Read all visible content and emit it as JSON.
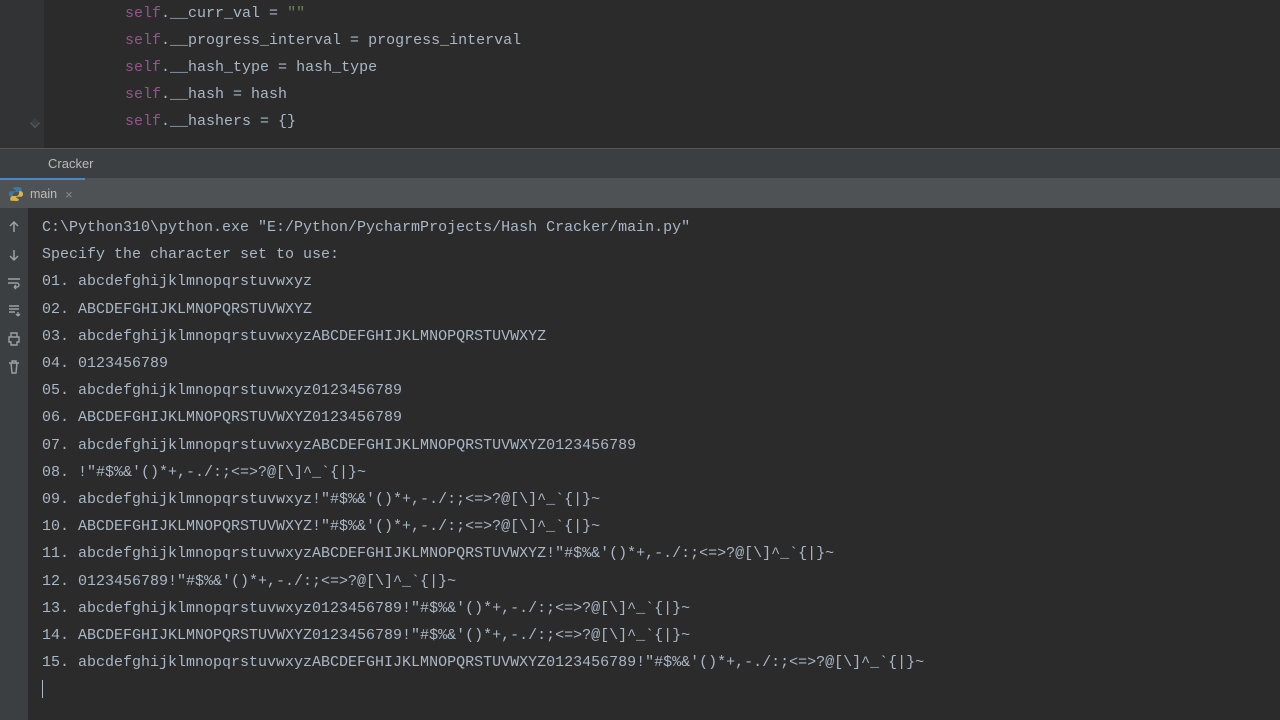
{
  "editor": {
    "lines": [
      {
        "self": "self",
        "field": ".__curr_val",
        "op": " = ",
        "rhs_type": "str",
        "rhs": "\"\""
      },
      {
        "self": "self",
        "field": ".__progress_interval",
        "op": " = ",
        "rhs_type": "ident",
        "rhs": "progress_interval"
      },
      {
        "self": "self",
        "field": ".__hash_type",
        "op": " = ",
        "rhs_type": "ident",
        "rhs": "hash_type"
      },
      {
        "self": "self",
        "field": ".__hash",
        "op": " = ",
        "rhs_type": "ident",
        "rhs": "hash"
      },
      {
        "self": "self",
        "field": ".__hashers",
        "op": " = ",
        "rhs_type": "brace",
        "rhs": "{}"
      }
    ]
  },
  "toolwindow": {
    "title": "Cracker"
  },
  "run_tab": {
    "label": "main",
    "close": "×"
  },
  "console": {
    "cmd": "C:\\Python310\\python.exe \"E:/Python/PycharmProjects/Hash Cracker/main.py\"",
    "prompt": "Specify the character set to use:",
    "blank": "",
    "options": [
      "01. abcdefghijklmnopqrstuvwxyz",
      "02. ABCDEFGHIJKLMNOPQRSTUVWXYZ",
      "03. abcdefghijklmnopqrstuvwxyzABCDEFGHIJKLMNOPQRSTUVWXYZ",
      "04. 0123456789",
      "05. abcdefghijklmnopqrstuvwxyz0123456789",
      "06. ABCDEFGHIJKLMNOPQRSTUVWXYZ0123456789",
      "07. abcdefghijklmnopqrstuvwxyzABCDEFGHIJKLMNOPQRSTUVWXYZ0123456789",
      "08. !\"#$%&'()*+,-./:;<=>?@[\\]^_`{|}~",
      "09. abcdefghijklmnopqrstuvwxyz!\"#$%&'()*+,-./:;<=>?@[\\]^_`{|}~",
      "10. ABCDEFGHIJKLMNOPQRSTUVWXYZ!\"#$%&'()*+,-./:;<=>?@[\\]^_`{|}~",
      "11. abcdefghijklmnopqrstuvwxyzABCDEFGHIJKLMNOPQRSTUVWXYZ!\"#$%&'()*+,-./:;<=>?@[\\]^_`{|}~",
      "12. 0123456789!\"#$%&'()*+,-./:;<=>?@[\\]^_`{|}~",
      "13. abcdefghijklmnopqrstuvwxyz0123456789!\"#$%&'()*+,-./:;<=>?@[\\]^_`{|}~",
      "14. ABCDEFGHIJKLMNOPQRSTUVWXYZ0123456789!\"#$%&'()*+,-./:;<=>?@[\\]^_`{|}~",
      "15. abcdefghijklmnopqrstuvwxyzABCDEFGHIJKLMNOPQRSTUVWXYZ0123456789!\"#$%&'()*+,-./:;<=>?@[\\]^_`{|}~"
    ]
  },
  "actions": {
    "up": "up-arrow-icon",
    "down": "down-arrow-icon",
    "soft_wrap": "soft-wrap-icon",
    "scroll_end": "scroll-end-icon",
    "print": "print-icon",
    "trash": "trash-icon"
  }
}
